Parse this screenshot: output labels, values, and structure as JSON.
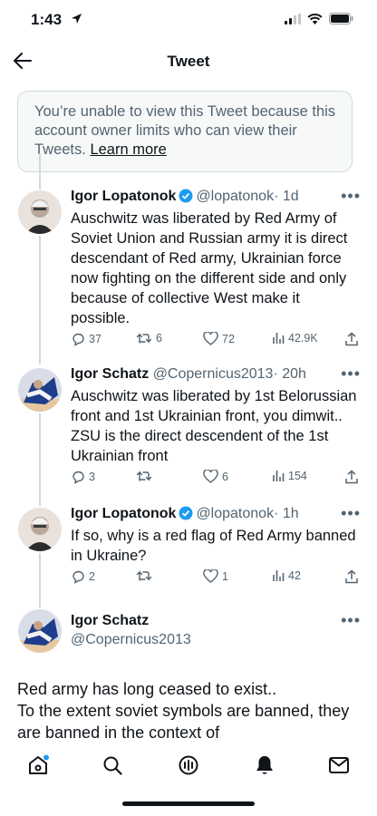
{
  "status": {
    "time": "1:43"
  },
  "header": {
    "title": "Tweet"
  },
  "notice": {
    "text": "You’re unable to view this Tweet because this account owner limits who can view their Tweets.",
    "link": "Learn more"
  },
  "tweets": [
    {
      "name": "Igor Lopatonok",
      "handle": "@lopatonok",
      "time": "· 1d",
      "verified": true,
      "body": "Auschwitz was liberated by Red Army of Soviet Union and Russian army it is direct descendant of Red army, Ukrainian force now fighting on the different side and only because of collective West make it possible.",
      "replies": "37",
      "retweets": "6",
      "likes": "72",
      "views": "42.9K"
    },
    {
      "name": "Igor Schatz",
      "handle": "@Copernicus2013",
      "time": "· 20h",
      "verified": false,
      "body": "Auschwitz was liberated by 1st Belorussian front and 1st Ukrainian front, you dimwit.. ZSU is the direct descendent of the 1st Ukrainian front",
      "replies": "3",
      "retweets": "",
      "likes": "6",
      "views": "154"
    },
    {
      "name": "Igor Lopatonok",
      "handle": "@lopatonok",
      "time": "· 1h",
      "verified": true,
      "body": "If so, why is a red flag of Red Army banned in Ukraine?",
      "replies": "2",
      "retweets": "",
      "likes": "1",
      "views": "42"
    }
  ],
  "focus": {
    "name": "Igor Schatz",
    "handle": "@Copernicus2013",
    "body": "Red army has long ceased to exist..\nTo the extent soviet symbols are banned, they are banned in the context of"
  },
  "colors": {
    "accent": "#1d9bf0",
    "text": "#0f1419",
    "muted": "#536471",
    "verified": "#1d9bf0"
  },
  "tabbar": {
    "icons": [
      "home-icon",
      "search-icon",
      "spaces-icon",
      "notifications-icon",
      "messages-icon"
    ],
    "active": "notifications-icon"
  }
}
